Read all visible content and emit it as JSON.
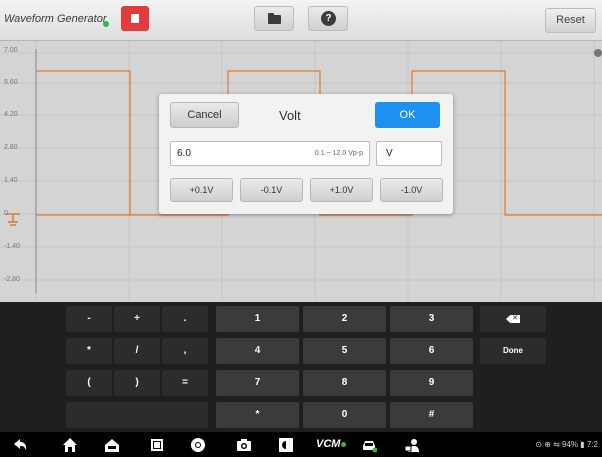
{
  "toolbar": {
    "app_title": "Waveform Generator",
    "reset_label": "Reset",
    "stop_icon": "stop-icon",
    "folder_icon": "folder-icon",
    "help_icon": "help-icon",
    "help_glyph": "?"
  },
  "plot": {
    "y_ticks": [
      "7.00",
      "5.60",
      "4.20",
      "2.80",
      "1.40",
      "0",
      "-1.40",
      "-2.80"
    ],
    "waveform_color": "#e07a2a",
    "ground_marker_color": "#e07a2a"
  },
  "dialog": {
    "cancel_label": "Cancel",
    "title": "Volt",
    "ok_label": "OK",
    "value": "6.0",
    "range_hint": "0.1 ~ 12.0 Vp-p",
    "unit": "V",
    "steps": [
      "+0.1V",
      "-0.1V",
      "+1.0V",
      "-1.0V"
    ],
    "ok_color": "#1e90f0"
  },
  "keyboard": {
    "symbols": [
      "-",
      "+",
      ".",
      "*",
      "/",
      ",",
      "(",
      ")",
      "="
    ],
    "digits": [
      "1",
      "2",
      "3",
      "4",
      "5",
      "6",
      "7",
      "8",
      "9",
      "*",
      "0",
      "#"
    ],
    "backspace_icon": "backspace-icon",
    "done_label": "Done"
  },
  "navbar": {
    "icons": [
      "back-icon",
      "home-icon",
      "car-home-icon",
      "recents-icon",
      "chrome-icon",
      "camera-icon",
      "brightness-icon",
      "vcm-icon",
      "vehicle-icon",
      "remote-icon"
    ],
    "vcm_label": "VCM",
    "status_text": "⊙ ⊕ ⇋ 94% ▮ 7:2"
  }
}
